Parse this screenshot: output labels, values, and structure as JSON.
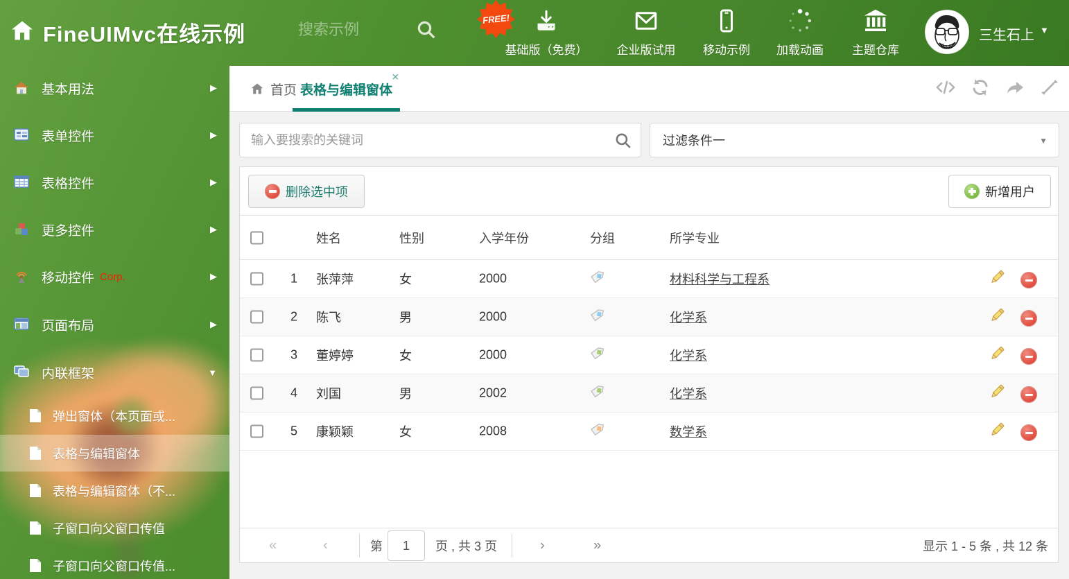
{
  "header": {
    "title": "FineUIMvc在线示例",
    "search_placeholder": "搜索示例",
    "free_badge": "FREE!",
    "nav": [
      {
        "label": "基础版（免费）",
        "icon": "download-icon"
      },
      {
        "label": "企业版试用",
        "icon": "envelope-icon"
      },
      {
        "label": "移动示例",
        "icon": "phone-icon"
      },
      {
        "label": "加载动画",
        "icon": "spinner-icon"
      },
      {
        "label": "主题仓库",
        "icon": "bank-icon"
      }
    ],
    "username": "三生石上"
  },
  "sidebar": {
    "items": [
      {
        "label": "基本用法",
        "icon": "home-icon"
      },
      {
        "label": "表单控件",
        "icon": "form-icon"
      },
      {
        "label": "表格控件",
        "icon": "table-icon"
      },
      {
        "label": "更多控件",
        "icon": "cubes-icon"
      },
      {
        "label": "移动控件",
        "icon": "antenna-icon",
        "badge": "Corp."
      },
      {
        "label": "页面布局",
        "icon": "layout-icon"
      },
      {
        "label": "内联框架",
        "icon": "frames-icon"
      }
    ],
    "subitems": [
      {
        "label": "弹出窗体（本页面或..."
      },
      {
        "label": "表格与编辑窗体",
        "selected": true
      },
      {
        "label": "表格与编辑窗体（不..."
      },
      {
        "label": "子窗口向父窗口传值"
      },
      {
        "label": "子窗口向父窗口传值..."
      }
    ]
  },
  "tabs": {
    "home": "首页",
    "active": "表格与编辑窗体",
    "close": "×"
  },
  "filters": {
    "search_placeholder": "输入要搜索的关键词",
    "filter_value": "过滤条件一"
  },
  "grid": {
    "delete_selected_label": "删除选中项",
    "add_user_label": "新增用户",
    "columns": {
      "name": "姓名",
      "gender": "性别",
      "year": "入学年份",
      "group": "分组",
      "major": "所学专业"
    },
    "rows": [
      {
        "index": "1",
        "name": "张萍萍",
        "gender": "女",
        "year": "2000",
        "tag_color": "#8ecdf0",
        "major": "材料科学与工程系"
      },
      {
        "index": "2",
        "name": "陈飞",
        "gender": "男",
        "year": "2000",
        "tag_color": "#8ecdf0",
        "major": "化学系"
      },
      {
        "index": "3",
        "name": "董婷婷",
        "gender": "女",
        "year": "2000",
        "tag_color": "#a5cf70",
        "major": "化学系"
      },
      {
        "index": "4",
        "name": "刘国",
        "gender": "男",
        "year": "2002",
        "tag_color": "#a5cf70",
        "major": "化学系"
      },
      {
        "index": "5",
        "name": "康颖颖",
        "gender": "女",
        "year": "2008",
        "tag_color": "#f6bc80",
        "major": "数学系"
      }
    ]
  },
  "pagination": {
    "prefix": "第",
    "page": "1",
    "suffix": "页 , 共 3 页",
    "first": "«",
    "prev": "‹",
    "next": "›",
    "last": "»",
    "summary": "显示 1 - 5 条 , 共 12 条"
  },
  "colors": {
    "accent_teal": "#0e7f70",
    "header_green": "#47862a",
    "free_badge_orange": "#f3490e",
    "corp_red": "#ff1a00"
  }
}
